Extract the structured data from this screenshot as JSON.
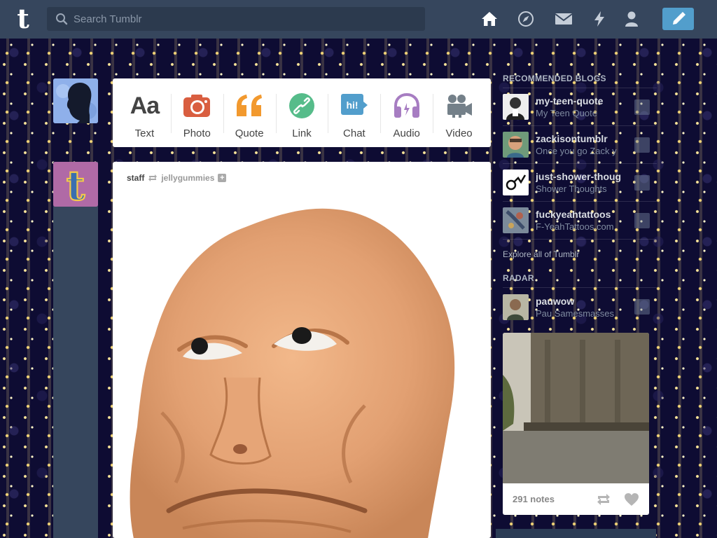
{
  "header": {
    "logo": "t",
    "search_placeholder": "Search Tumblr",
    "nav": [
      {
        "name": "home-icon"
      },
      {
        "name": "explore-icon"
      },
      {
        "name": "inbox-icon"
      },
      {
        "name": "activity-icon"
      },
      {
        "name": "account-icon"
      }
    ],
    "compose_icon": "pencil-icon"
  },
  "post_types": [
    {
      "label": "Text",
      "icon": "text-icon",
      "color": "#444444"
    },
    {
      "label": "Photo",
      "icon": "camera-icon",
      "color": "#d95e40"
    },
    {
      "label": "Quote",
      "icon": "quote-icon",
      "color": "#f2992e"
    },
    {
      "label": "Link",
      "icon": "link-icon",
      "color": "#56bc8a"
    },
    {
      "label": "Chat",
      "icon": "chat-icon",
      "color": "#529ecc"
    },
    {
      "label": "Audio",
      "icon": "headphones-icon",
      "color": "#a77dc2"
    },
    {
      "label": "Video",
      "icon": "video-camera-icon",
      "color": "#748089"
    }
  ],
  "post": {
    "author": "staff",
    "reblogged_from": "jellygummies"
  },
  "sidebar": {
    "recommended_title": "RECOMMENDED BLOGS",
    "recommended": [
      {
        "name": "my-teen-quote",
        "subtitle": "My Teen Quote"
      },
      {
        "name": "zackisontumblr",
        "subtitle": "Once you go Zack y"
      },
      {
        "name": "just-shower-thoug",
        "subtitle": "Shower Thoughts"
      },
      {
        "name": "fuckyeahtattoos",
        "subtitle": "F-YeahTattoos.com"
      }
    ],
    "explore_link": "Explore all of Tumblr",
    "radar_title": "RADAR",
    "radar": {
      "name": "pauwow",
      "subtitle": "Pau Samesmasses",
      "notes": "291 notes"
    }
  },
  "colors": {
    "header": "#36465d",
    "compose": "#529ecc",
    "background": "#0e0c33"
  }
}
